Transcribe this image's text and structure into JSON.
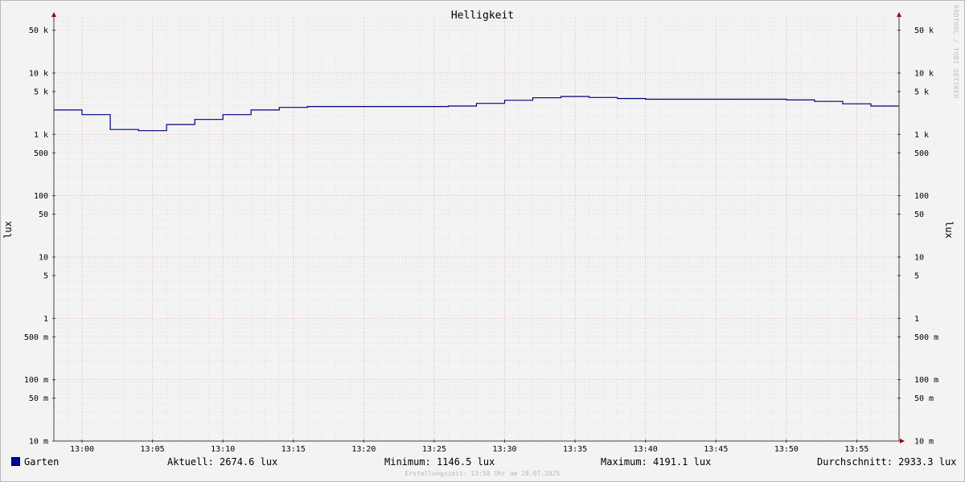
{
  "chart_data": {
    "type": "line",
    "title": "Helligkeit",
    "ylabel_left": "lux",
    "ylabel_right": "lux",
    "y_scale": "log",
    "ylim": [
      0.01,
      80000
    ],
    "xlim": [
      "12:58",
      "13:58"
    ],
    "x_ticks": [
      "13:00",
      "13:05",
      "13:10",
      "13:15",
      "13:20",
      "13:25",
      "13:30",
      "13:35",
      "13:40",
      "13:45",
      "13:50",
      "13:55"
    ],
    "y_ticks": [
      {
        "value": 50000,
        "label": "50 k"
      },
      {
        "value": 10000,
        "label": "10 k"
      },
      {
        "value": 5000,
        "label": "5 k"
      },
      {
        "value": 1000,
        "label": "1 k"
      },
      {
        "value": 500,
        "label": "500"
      },
      {
        "value": 100,
        "label": "100"
      },
      {
        "value": 50,
        "label": "50"
      },
      {
        "value": 10,
        "label": "10"
      },
      {
        "value": 5,
        "label": "5"
      },
      {
        "value": 1,
        "label": "1"
      },
      {
        "value": 0.5,
        "label": "500 m"
      },
      {
        "value": 0.1,
        "label": "100 m"
      },
      {
        "value": 0.05,
        "label": "50 m"
      },
      {
        "value": 0.01,
        "label": "10 m"
      }
    ],
    "grid": true,
    "series": [
      {
        "name": "Garten",
        "color": "#000080",
        "step": true,
        "x": [
          "12:58",
          "13:00",
          "13:02",
          "13:04",
          "13:06",
          "13:08",
          "13:10",
          "13:12",
          "13:14",
          "13:16",
          "13:18",
          "13:20",
          "13:22",
          "13:24",
          "13:26",
          "13:28",
          "13:30",
          "13:32",
          "13:34",
          "13:36",
          "13:38",
          "13:40",
          "13:42",
          "13:44",
          "13:46",
          "13:48",
          "13:50",
          "13:52",
          "13:54",
          "13:56"
        ],
        "y": [
          2500,
          2100,
          1200,
          1150,
          1450,
          1750,
          2100,
          2500,
          2750,
          2850,
          2850,
          2850,
          2850,
          2850,
          2900,
          3200,
          3600,
          3950,
          4150,
          4000,
          3850,
          3750,
          3750,
          3750,
          3750,
          3750,
          3650,
          3450,
          3150,
          2900
        ]
      }
    ]
  },
  "legend": {
    "series_name": "Garten",
    "aktuell": "Aktuell: 2674.6 lux",
    "minimum": "Minimum: 1146.5 lux",
    "maximum": "Maximum: 4191.1 lux",
    "durchschnitt": "Durchschnitt: 2933.3 lux"
  },
  "watermark": "RRDTOOL / TOBI OETIKER",
  "footer": "Erstellungszeit: 13:58 Uhr am 28.07.2025"
}
